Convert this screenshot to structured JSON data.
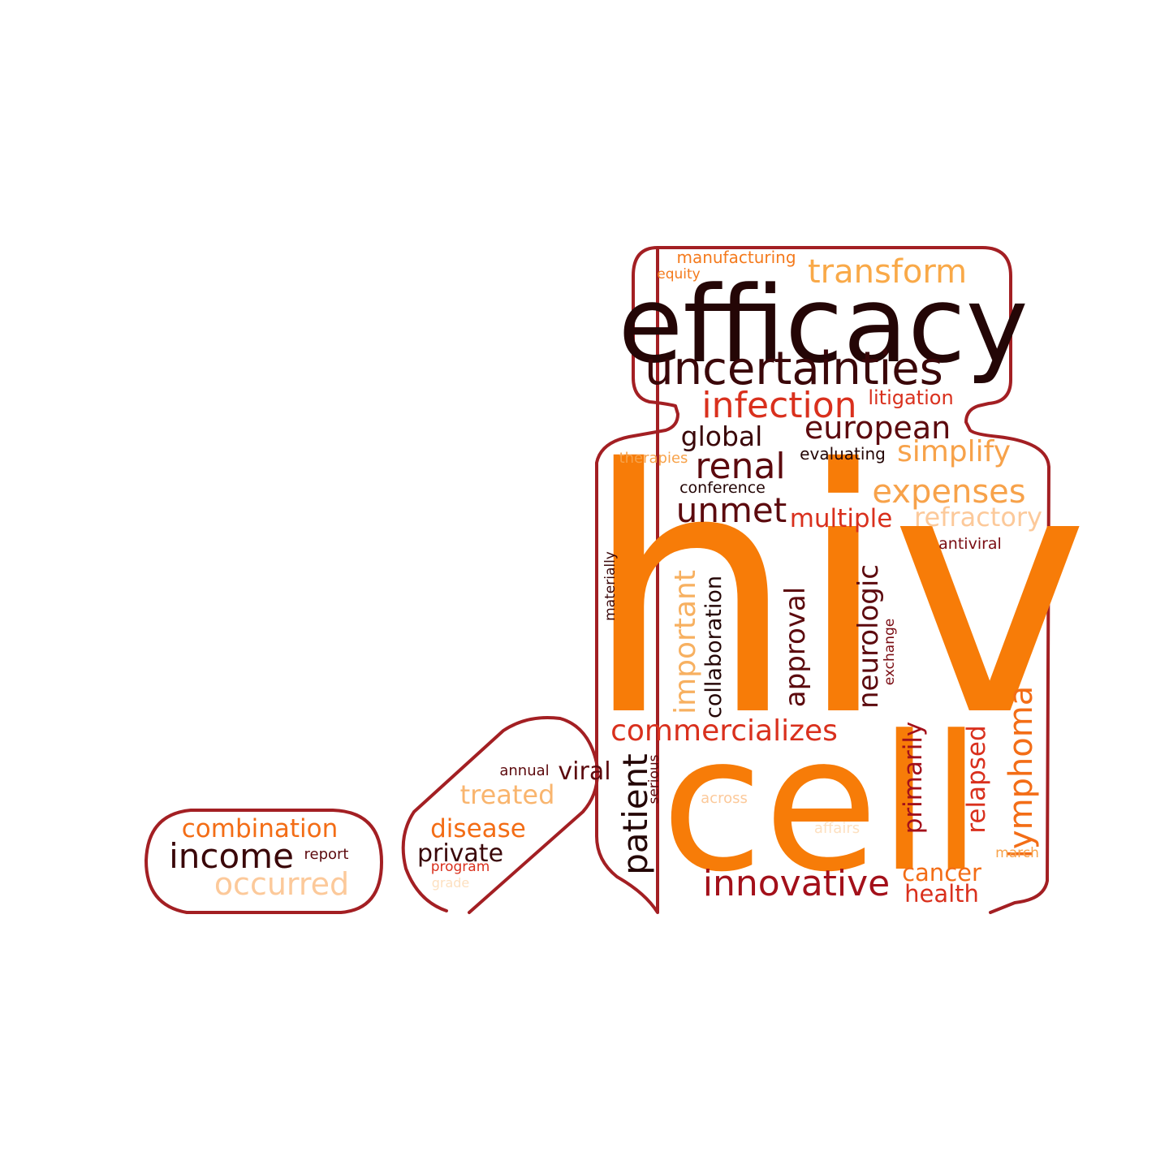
{
  "colors": {
    "outline": "#a31f23",
    "palette": [
      "#240606",
      "#5c0a0e",
      "#a3101a",
      "#d9301d",
      "#f36d16",
      "#f7a24a",
      "#fcc99a",
      "#fde0c0"
    ]
  },
  "words": [
    {
      "text": "hiv",
      "color": "#f77c08"
    },
    {
      "text": "cell",
      "color": "#f77c08"
    },
    {
      "text": "efficacy",
      "color": "#240606"
    },
    {
      "text": "uncertainties",
      "color": "#3a0709"
    },
    {
      "text": "transform",
      "color": "#f9a948"
    },
    {
      "text": "manufacturing",
      "color": "#f47a1c"
    },
    {
      "text": "equity",
      "color": "#f47a1c"
    },
    {
      "text": "infection",
      "color": "#d9301d"
    },
    {
      "text": "litigation",
      "color": "#d9301d"
    },
    {
      "text": "european",
      "color": "#5c0a0e"
    },
    {
      "text": "global",
      "color": "#3a0709"
    },
    {
      "text": "evaluating",
      "color": "#240606"
    },
    {
      "text": "simplify",
      "color": "#f7a24a"
    },
    {
      "text": "therapies",
      "color": "#f7a24a"
    },
    {
      "text": "renal",
      "color": "#5c0a0e"
    },
    {
      "text": "conference",
      "color": "#240606"
    },
    {
      "text": "expenses",
      "color": "#f7a24a"
    },
    {
      "text": "unmet",
      "color": "#5c0a0e"
    },
    {
      "text": "multiple",
      "color": "#d9301d"
    },
    {
      "text": "refractory",
      "color": "#fcc99a"
    },
    {
      "text": "antiviral",
      "color": "#7a0c12"
    },
    {
      "text": "materially",
      "color": "#3a0709"
    },
    {
      "text": "important",
      "color": "#f7b060"
    },
    {
      "text": "collaboration",
      "color": "#240606"
    },
    {
      "text": "approval",
      "color": "#5c0a0e"
    },
    {
      "text": "neurologic",
      "color": "#5c0a0e"
    },
    {
      "text": "exchange",
      "color": "#7a0c12"
    },
    {
      "text": "commercializes",
      "color": "#d9301d"
    },
    {
      "text": "patient",
      "color": "#240606"
    },
    {
      "text": "serious",
      "color": "#5c0a0e"
    },
    {
      "text": "primarily",
      "color": "#a3101a"
    },
    {
      "text": "relapsed",
      "color": "#d9301d"
    },
    {
      "text": "lymphoma",
      "color": "#f36d16"
    },
    {
      "text": "across",
      "color": "#fcc99a"
    },
    {
      "text": "affairs",
      "color": "#fde0c0"
    },
    {
      "text": "march",
      "color": "#f7a24a"
    },
    {
      "text": "innovative",
      "color": "#a3101a"
    },
    {
      "text": "cancer",
      "color": "#f36d16"
    },
    {
      "text": "health",
      "color": "#d9301d"
    },
    {
      "text": "annual",
      "color": "#5c0a0e"
    },
    {
      "text": "viral",
      "color": "#5c0a0e"
    },
    {
      "text": "treated",
      "color": "#f9b56e"
    },
    {
      "text": "disease",
      "color": "#f36d16"
    },
    {
      "text": "private",
      "color": "#3a0709"
    },
    {
      "text": "program",
      "color": "#d9301d"
    },
    {
      "text": "grade",
      "color": "#fde0c0"
    },
    {
      "text": "combination",
      "color": "#f36d16"
    },
    {
      "text": "income",
      "color": "#3a0709"
    },
    {
      "text": "report",
      "color": "#5c0a0e"
    },
    {
      "text": "occurred",
      "color": "#fcc99a"
    }
  ]
}
